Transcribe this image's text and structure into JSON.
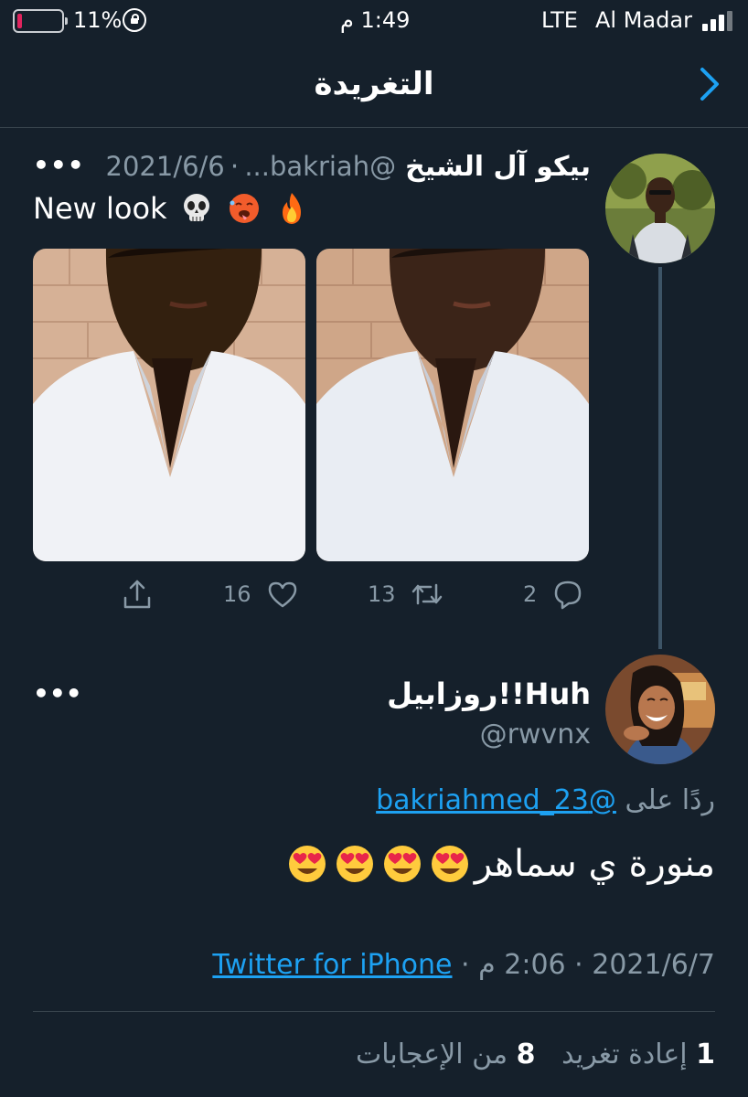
{
  "status_bar": {
    "battery_percent": "11%",
    "battery_level": 0.11,
    "time": "1:49 م",
    "network": "LTE",
    "carrier": "Al Madar"
  },
  "header": {
    "title": "التغريدة",
    "back_icon": "chevron-right-icon"
  },
  "original_tweet": {
    "author_name": "بيكو آل الشيخ",
    "handle": "@bakriah...",
    "date": "2021/6/6",
    "menu": "•••",
    "text": "New look",
    "emojis": [
      "skull-emoji",
      "hot-face-emoji",
      "fire-emoji"
    ],
    "actions": {
      "reply_count": "2",
      "retweet_count": "13",
      "like_count": "16"
    }
  },
  "reply_tweet": {
    "author_name": "روزابيل!!Huh",
    "handle": "@rwvnx",
    "menu": "•••",
    "replying_prefix": "ردًا على",
    "replying_to": "@bakriahmed_23",
    "text": "منورة ي سماهر",
    "emojis": [
      "heart-eyes-emoji",
      "heart-eyes-emoji",
      "heart-eyes-emoji",
      "heart-eyes-emoji"
    ],
    "date": "2021/6/7",
    "time": "2:06 م",
    "source": "Twitter for iPhone",
    "retweets": "1",
    "retweets_label": "إعادة تغريد",
    "likes": "8",
    "likes_label": "من الإعجابات"
  },
  "colors": {
    "background": "#15202b",
    "accent": "#1da1f2",
    "secondary_text": "#8899a6",
    "divider": "#38444d"
  }
}
